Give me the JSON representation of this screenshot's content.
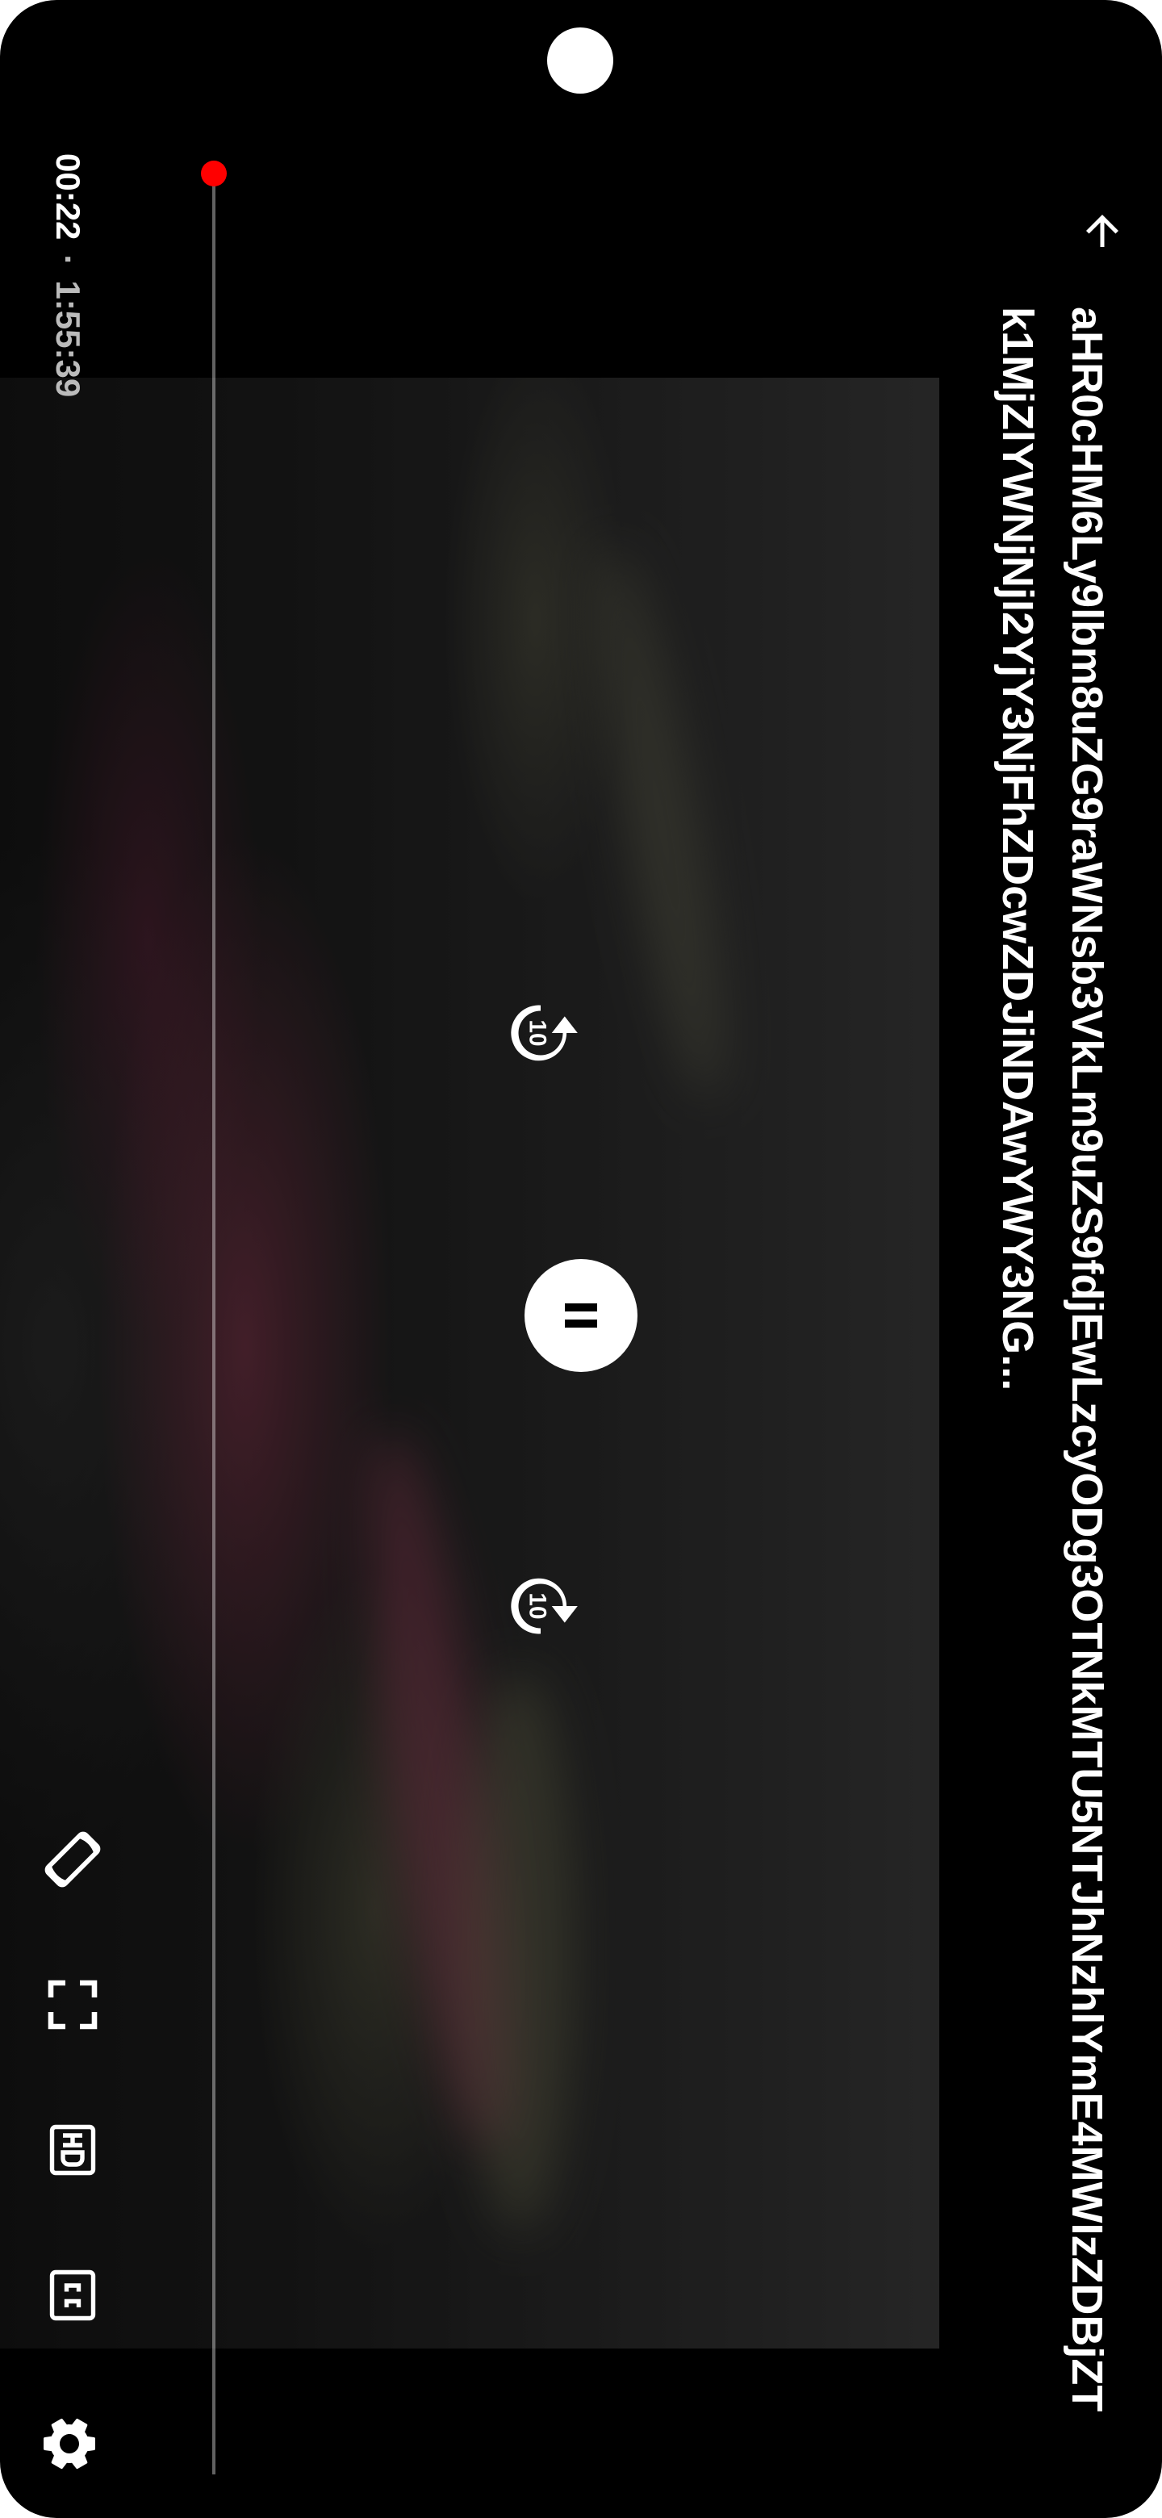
{
  "video": {
    "title": "aHR0cHM6Ly9lbm8uZG9raWNsb3VkLm9uZS9fdjEwLzcyODg3OTNkMTU5NTJhNzhlYmE4MWIzZDBjZTk1MjZlYWNjNjI2YjY3NjFhZDcwZDJiNDAwYWY3NG..."
  },
  "playback": {
    "current_time": "00:22",
    "separator": "·",
    "total_duration": "1:55:39",
    "progress_fraction": 0.0032
  },
  "controls": {
    "rewind_seconds": "10",
    "forward_seconds": "10",
    "play_state": "playing"
  },
  "icons": {
    "back": "arrow-back-icon",
    "rewind": "replay-10-icon",
    "pause": "pause-icon",
    "forward": "forward-10-icon",
    "rotate": "screen-rotation-icon",
    "fullscreen": "fullscreen-icon",
    "quality": "hd-icon",
    "captions": "closed-captions-icon",
    "settings": "gear-icon"
  },
  "colors": {
    "progress": "#ff0000",
    "icon": "#ffffff",
    "background": "#000000"
  }
}
